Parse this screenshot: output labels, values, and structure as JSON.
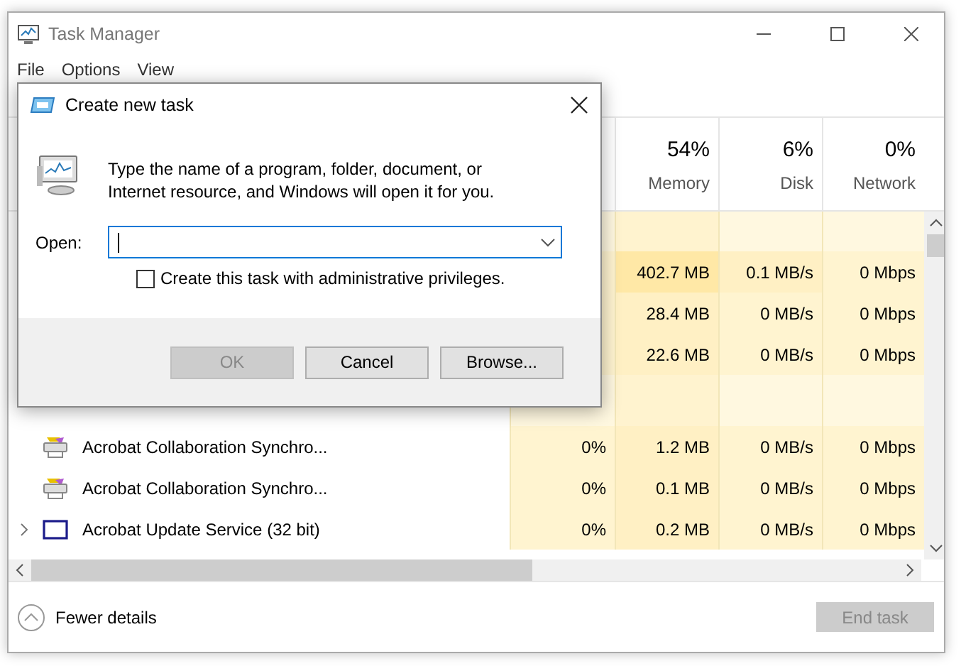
{
  "window": {
    "title": "Task Manager"
  },
  "menu": [
    {
      "label": "File"
    },
    {
      "label": "Options"
    },
    {
      "label": "View"
    }
  ],
  "columns": [
    {
      "percent": "54%",
      "label": "Memory"
    },
    {
      "percent": "6%",
      "label": "Disk"
    },
    {
      "percent": "0%",
      "label": "Network"
    }
  ],
  "rows": [
    {
      "kind": "blank"
    },
    {
      "kind": "hidden",
      "cells": [
        {
          "text": "402.7 MB",
          "color": "#ffe8a6"
        },
        {
          "text": "0.1 MB/s",
          "color": "#fff0c4"
        },
        {
          "text": "0 Mbps",
          "color": "#fff4d0"
        }
      ]
    },
    {
      "kind": "hidden",
      "cells": [
        {
          "text": "28.4 MB",
          "color": "#fff0c4"
        },
        {
          "text": "0 MB/s",
          "color": "#fff4d0"
        },
        {
          "text": "0 Mbps",
          "color": "#fff4d0"
        }
      ]
    },
    {
      "kind": "hidden",
      "cells": [
        {
          "text": "22.6 MB",
          "color": "#fff0c4"
        },
        {
          "text": "0 MB/s",
          "color": "#fff4d0"
        },
        {
          "text": "0 Mbps",
          "color": "#fff4d0"
        }
      ]
    },
    {
      "kind": "group"
    },
    {
      "kind": "sync",
      "expandable": false,
      "name": "Acrobat Collaboration Synchro...",
      "cells": [
        {
          "text": "0%",
          "color": "#fff4d0"
        },
        {
          "text": "1.2 MB",
          "color": "#fff0c4"
        },
        {
          "text": "0 MB/s",
          "color": "#fff4d0"
        },
        {
          "text": "0 Mbps",
          "color": "#fff4d0"
        }
      ]
    },
    {
      "kind": "sync",
      "expandable": false,
      "name": "Acrobat Collaboration Synchro...",
      "cells": [
        {
          "text": "0%",
          "color": "#fff4d0"
        },
        {
          "text": "0.1 MB",
          "color": "#fff0c4"
        },
        {
          "text": "0 MB/s",
          "color": "#fff4d0"
        },
        {
          "text": "0 Mbps",
          "color": "#fff4d0"
        }
      ]
    },
    {
      "kind": "service",
      "expandable": true,
      "name": "Acrobat Update Service (32 bit)",
      "cells": [
        {
          "text": "0%",
          "color": "#fff4d0"
        },
        {
          "text": "0.2 MB",
          "color": "#fff0c4"
        },
        {
          "text": "0 MB/s",
          "color": "#fff4d0"
        },
        {
          "text": "0 Mbps",
          "color": "#fff4d0"
        }
      ]
    }
  ],
  "footer": {
    "details": "Fewer details",
    "end_task": {
      "label": "End task",
      "disabled": true
    }
  },
  "dialog": {
    "title": "Create new task",
    "message": "Type the name of a program, folder, document, or Internet resource, and Windows will open it for you.",
    "open_label": "Open:",
    "checkbox": {
      "label": "Create this task with administrative privileges.",
      "checked": false
    },
    "buttons": [
      {
        "label": "OK",
        "disabled": true
      },
      {
        "label": "Cancel",
        "disabled": false
      },
      {
        "label": "Browse...",
        "disabled": false
      }
    ]
  }
}
